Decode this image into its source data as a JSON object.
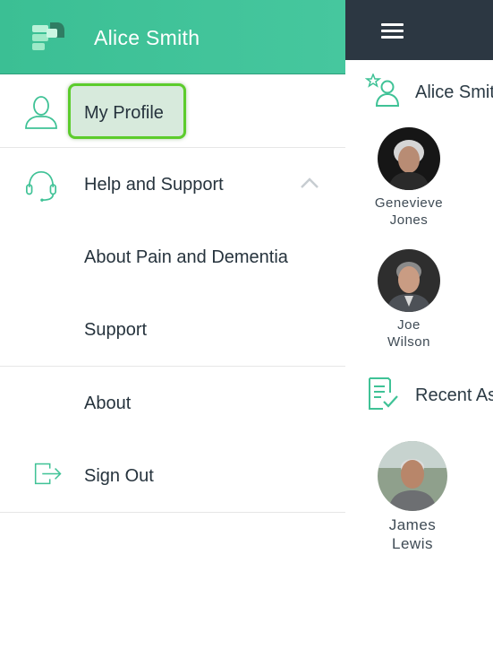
{
  "drawer": {
    "user_name": "Alice Smith",
    "items": [
      {
        "label": "My Profile",
        "icon": "user-outline-icon",
        "highlighted": true
      },
      {
        "label": "Help and Support",
        "icon": "headset-icon",
        "expanded": true
      },
      {
        "label": "About Pain and Dementia"
      },
      {
        "label": "Support"
      },
      {
        "label": "About"
      },
      {
        "label": "Sign Out",
        "icon": "sign-out-icon"
      }
    ]
  },
  "background": {
    "favorites_title": "Alice Smit",
    "recent_title": "Recent As",
    "residents": [
      {
        "first": "Genevieve",
        "last": "Jones"
      },
      {
        "first": "Joe",
        "last": "Wilson"
      }
    ],
    "recent": [
      {
        "first": "James",
        "last": "Lewis"
      }
    ]
  },
  "colors": {
    "accent": "#3fc296",
    "topbar": "#2c3742",
    "highlight_border": "#5ccc2c",
    "highlight_fill": "#d7eadc"
  }
}
